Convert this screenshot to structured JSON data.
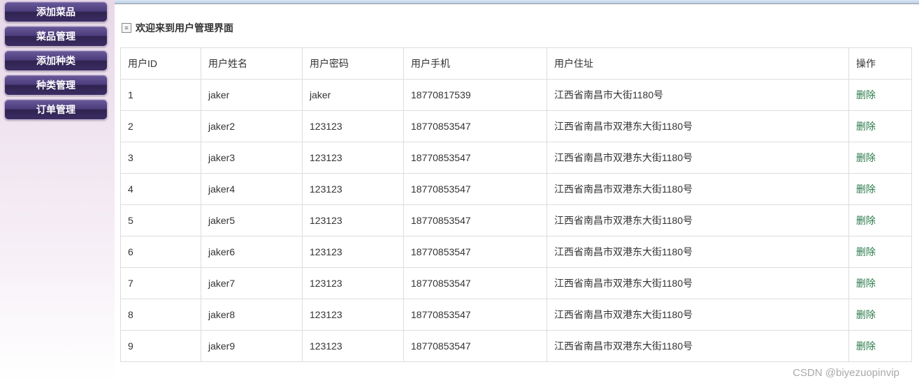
{
  "sidebar": {
    "items": [
      {
        "label": "添加菜品"
      },
      {
        "label": "菜品管理"
      },
      {
        "label": "添加种类"
      },
      {
        "label": "种类管理"
      },
      {
        "label": "订单管理"
      }
    ]
  },
  "main": {
    "welcome": "欢迎来到用户管理界面",
    "table": {
      "headers": {
        "id": "用户ID",
        "name": "用户姓名",
        "password": "用户密码",
        "phone": "用户手机",
        "address": "用户住址",
        "op": "操作"
      },
      "op_label": "删除",
      "rows": [
        {
          "id": "1",
          "name": "jaker",
          "password": "jaker",
          "phone": "18770817539",
          "address": "江西省南昌市大街1180号"
        },
        {
          "id": "2",
          "name": "jaker2",
          "password": "123123",
          "phone": "18770853547",
          "address": "江西省南昌市双港东大街1180号"
        },
        {
          "id": "3",
          "name": "jaker3",
          "password": "123123",
          "phone": "18770853547",
          "address": "江西省南昌市双港东大街1180号"
        },
        {
          "id": "4",
          "name": "jaker4",
          "password": "123123",
          "phone": "18770853547",
          "address": "江西省南昌市双港东大街1180号"
        },
        {
          "id": "5",
          "name": "jaker5",
          "password": "123123",
          "phone": "18770853547",
          "address": "江西省南昌市双港东大街1180号"
        },
        {
          "id": "6",
          "name": "jaker6",
          "password": "123123",
          "phone": "18770853547",
          "address": "江西省南昌市双港东大街1180号"
        },
        {
          "id": "7",
          "name": "jaker7",
          "password": "123123",
          "phone": "18770853547",
          "address": "江西省南昌市双港东大街1180号"
        },
        {
          "id": "8",
          "name": "jaker8",
          "password": "123123",
          "phone": "18770853547",
          "address": "江西省南昌市双港东大街1180号"
        },
        {
          "id": "9",
          "name": "jaker9",
          "password": "123123",
          "phone": "18770853547",
          "address": "江西省南昌市双港东大街1180号"
        }
      ]
    }
  },
  "watermark": "CSDN @biyezuopinvip"
}
